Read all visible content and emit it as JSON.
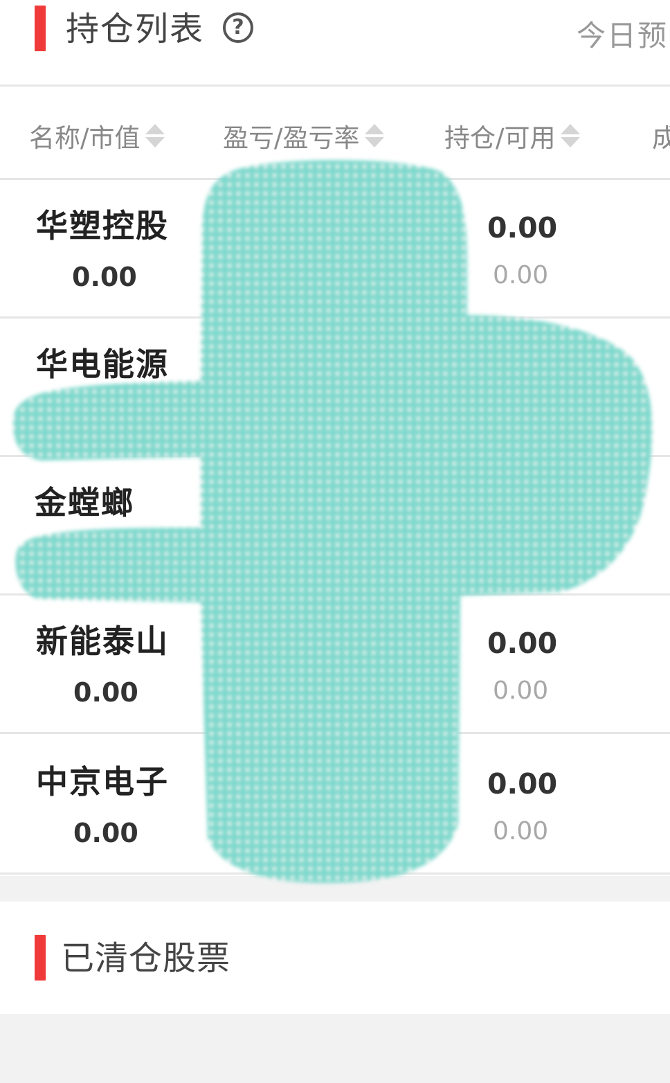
{
  "positions_section": {
    "title": "持仓列表",
    "help_icon": "question-circle-icon",
    "today_estimate_label": "今日预"
  },
  "columns": [
    {
      "label": "名称/市值"
    },
    {
      "label": "盈亏/盈亏率"
    },
    {
      "label": "持仓/可用"
    },
    {
      "label": "成"
    }
  ],
  "stocks": [
    {
      "name": "华塑控股",
      "market_value": "0.00",
      "holding": "0.00",
      "available": "0.00"
    },
    {
      "name": "华电能源"
    },
    {
      "name": "金螳螂"
    },
    {
      "name": "新能泰山",
      "market_value": "0.00",
      "holding": "0.00",
      "available": "0.00"
    },
    {
      "name": "中京电子",
      "market_value": "0.00",
      "holding": "0.00",
      "available": "0.00"
    }
  ],
  "cleared_section": {
    "title": "已清仓股票"
  },
  "colors": {
    "accent_red": "#f03a3a",
    "redaction_teal": "#7dd8cc"
  }
}
